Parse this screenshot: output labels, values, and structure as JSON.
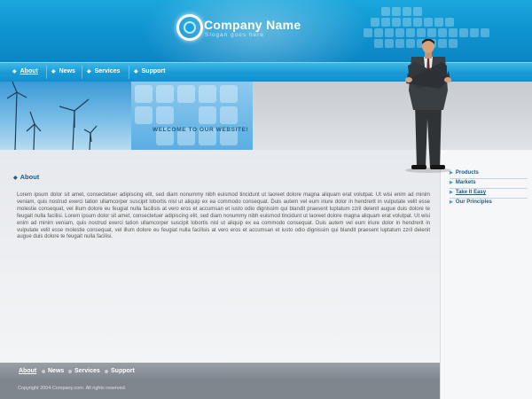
{
  "header": {
    "company_name": "Company Name",
    "slogan": "Slogan goes here"
  },
  "nav": {
    "items": [
      {
        "label": "About"
      },
      {
        "label": "News"
      },
      {
        "label": "Services"
      },
      {
        "label": "Support"
      }
    ]
  },
  "banner": {
    "welcome": "WELCOME TO OUR WEBSITE!"
  },
  "main": {
    "section_title": "About",
    "body": "Lorem ipsum dolor sit amet, consectetuer adipiscing elit, sed diam nonummy nibh euismod tincidunt ut laoreet dolore magna aliquam erat volutpat. Ut wisi enim ad minim veniam, quis nostrud exerci tation ullamcorper suscipit lobortis nisl ut aliquip ex ea commodo consequat. Duis autem vel eum iriure dolor in hendrerit in vulputate velit esse molestie consequat, vel illum dolore eu feugiat nulla facilisis at vero eros et accumsan et iusto odio dignissim qui blandit praesent luptatum zzril delenit augue duis dolore te feugait nulla facilisi. Lorem ipsum dolor sit amet, consectetuer adipiscing elit, sed diam nonummy nibh euismod tincidunt ut laoreet dolore magna aliquam erat volutpat. Ut wisi enim ad minim veniam, quis nostrud exerci tation ullamcorper suscipit lobortis nisl ut aliquip ex ea commodo consequat. Duis autem vel eum iriure dolor in hendrerit in vulputate velit esse molestie consequat, vel illum dolore eu feugiat nulla facilisis at vero eros et accumsan et iusto odio dignissim qui blandit praesent luptatum zzril delenit augue duis dolore te feugait nulla facilisi."
  },
  "sidebar": {
    "items": [
      {
        "label": "Products"
      },
      {
        "label": "Markets"
      },
      {
        "label": "Take It Easy"
      },
      {
        "label": "Our Principles"
      }
    ]
  },
  "footer": {
    "nav": [
      {
        "label": "About"
      },
      {
        "label": "News"
      },
      {
        "label": "Services"
      },
      {
        "label": "Support"
      }
    ],
    "copyright": "Copyright 2004 Company.com. All rights reserved."
  },
  "colors": {
    "header_blue": "#0f92cf",
    "nav_blue": "#1b9bd6",
    "link_blue": "#1a5d86",
    "footer_gray": "#7e858c"
  }
}
